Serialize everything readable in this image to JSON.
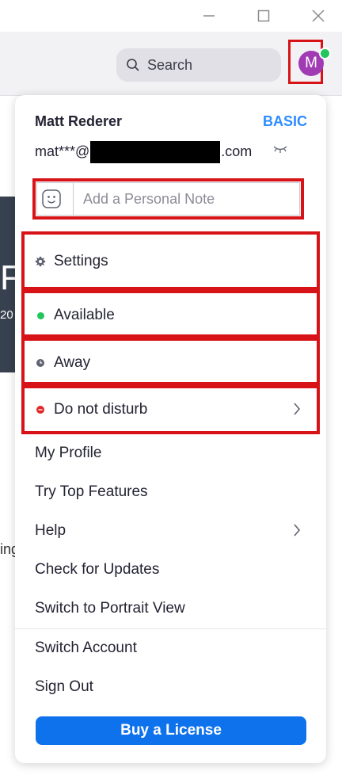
{
  "window": {
    "minimize_icon": "minimize-icon",
    "maximize_icon": "maximize-icon",
    "close_icon": "close-icon"
  },
  "header": {
    "search_label": "Search",
    "avatar_initial": "M",
    "avatar_color": "#a03bb4",
    "presence_color": "#22c55e"
  },
  "background": {
    "card_letter": "F",
    "card_number": "20",
    "side_text": "ing"
  },
  "profile": {
    "name": "Matt Rederer",
    "plan": "BASIC",
    "email_prefix": "mat***@",
    "email_suffix": ".com",
    "note_placeholder": "Add a Personal Note"
  },
  "menu": {
    "settings": "Settings",
    "available": "Available",
    "away": "Away",
    "do_not_disturb": "Do not disturb",
    "my_profile": "My Profile",
    "try_top_features": "Try Top Features",
    "help": "Help",
    "check_updates": "Check for Updates",
    "portrait_view": "Switch to Portrait View",
    "switch_account": "Switch Account",
    "sign_out": "Sign Out",
    "buy_license": "Buy a License"
  },
  "colors": {
    "highlight": "#d81317",
    "accent": "#2d8cff",
    "button": "#0e72ed",
    "available": "#22c55e",
    "away": "#5f6370",
    "dnd": "#e02828"
  }
}
